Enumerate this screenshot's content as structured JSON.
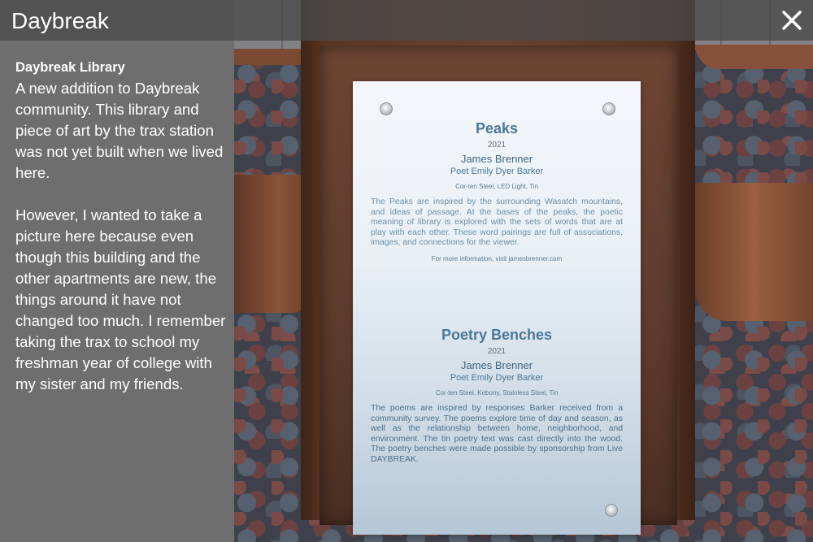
{
  "window": {
    "title": "Daybreak",
    "close_icon": "close-icon"
  },
  "story": {
    "heading": "Daybreak Library",
    "paragraphs": [
      "A new addition to Daybreak community. This library and piece of art by the trax station was not yet built when we lived here.",
      "However, I wanted to take a picture here because even though this building and the other apartments are new, the things around it have not changed too much. I remember taking the trax to school my freshman year of college with my sister and my friends."
    ]
  },
  "plaque": {
    "peaks": {
      "title": "Peaks",
      "year": "2021",
      "artist": "James Brenner",
      "poet": "Poet Emily Dyer Barker",
      "materials": "Cor-ten Steel, LED Light, Tin",
      "description": "The Peaks are inspired by the surrounding Wasatch mountains, and ideas of passage. At the bases of the peaks, the poetic meaning of library is explored with the sets of words that are at play with each other. These word pairings are full of associations, images, and connections for the viewer.",
      "link": "For more information, visit jamesbrenner.com"
    },
    "benches": {
      "title": "Poetry Benches",
      "year": "2021",
      "artist": "James Brenner",
      "poet": "Poet Emily Dyer Barker",
      "materials": "Cor-ten Steel, Kebony, Stainless Steel, Tin",
      "description": "The poems are inspired by responses Barker received from a community survey. The poems explore time of day and season, as well as the relationship between home, neighborhood, and environment. The tin poetry text was cast directly into the wood. The poetry benches were made possible by sponsorship from Live DAYBREAK."
    }
  },
  "colors": {
    "panel": "#6e6e6e",
    "title_bar": "#4a4a4a",
    "plaque_text": "#4b7898"
  }
}
